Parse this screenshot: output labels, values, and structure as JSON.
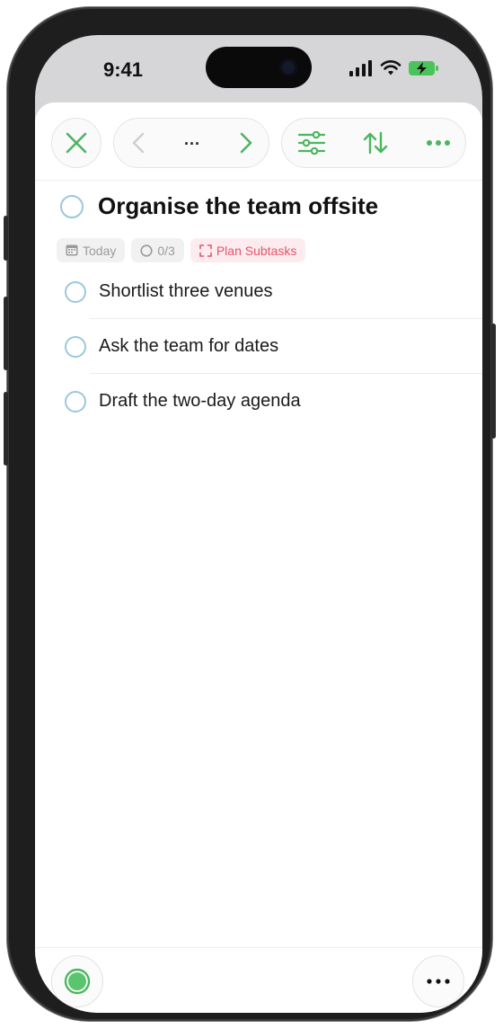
{
  "status_bar": {
    "time": "9:41"
  },
  "toolbar": {
    "nav_indicator": "..."
  },
  "task": {
    "title": "Organise the team offsite",
    "chips": {
      "date": "Today",
      "progress": "0/3",
      "plan": "Plan Subtasks"
    },
    "subtasks": [
      {
        "label": "Shortlist three venues",
        "done": false
      },
      {
        "label": "Ask the team for dates",
        "done": false
      },
      {
        "label": "Draft the two-day agenda",
        "done": false
      }
    ]
  },
  "icons": {
    "close": "close-icon",
    "back": "chevron-left-icon",
    "forward": "chevron-right-icon",
    "filter": "sliders-icon",
    "sort": "sort-icon",
    "more": "more-icon",
    "status": "green-circle-icon"
  },
  "colors": {
    "accent_green": "#4cb560",
    "checkbox_blue": "#9bc7dd",
    "plan_red": "#e4546b",
    "chip_grey": "#9a9a9a"
  }
}
